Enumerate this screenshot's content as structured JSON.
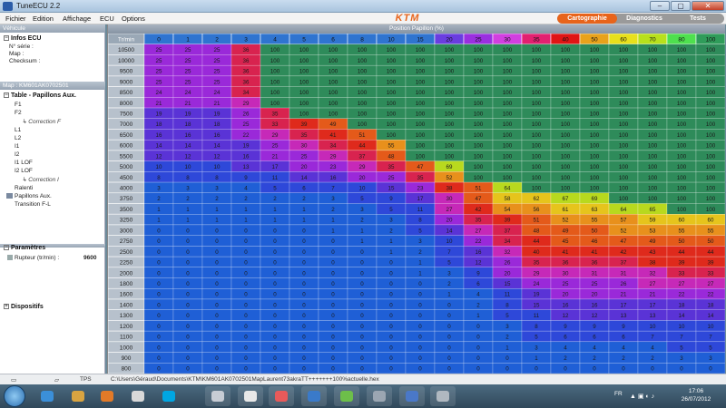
{
  "window": {
    "title": "TuneECU 2.2",
    "minimize": "–",
    "maximize": "▢",
    "close": "✕"
  },
  "menu": [
    "Fichier",
    "Edition",
    "Affichage",
    "ECU",
    "Options"
  ],
  "brand": "KTM",
  "mode_tabs": [
    "Cartographie",
    "Diagnostics",
    "Tests"
  ],
  "left_panel": {
    "vehicule_bar": "Véhicule",
    "infos_title": "Infos ECU",
    "info_lines": [
      "N° série :",
      "Map :",
      "Checksum :"
    ],
    "map_bar": "Map : KM601AK0702501",
    "table_title": "Table - Papillons Aux.",
    "tree": [
      "F1",
      "F2",
      "Correction F",
      "L1",
      "L2",
      "I1",
      "I2",
      "I1 LOF",
      "I2 LOF",
      "Correction I",
      "Ralenti",
      "Papillons Aux.",
      "Transition F-L"
    ],
    "params_title": "Paramètres",
    "param_label": "Rupteur (tr/min) :",
    "param_value": "9600",
    "dispositifs_title": "Dispositifs"
  },
  "grid_title": "Position Papillon (%)",
  "table": {
    "corner": "Tr/min",
    "columns": [
      "0",
      "1",
      "2",
      "3",
      "4",
      "5",
      "6",
      "8",
      "10",
      "15",
      "20",
      "25",
      "30",
      "35",
      "40",
      "50",
      "60",
      "70",
      "80",
      "100"
    ],
    "rows": [
      {
        "rpm": "10500",
        "cells": [
          "25",
          "25",
          "25",
          "36",
          "100",
          "100",
          "100",
          "100",
          "100",
          "100",
          "100",
          "100",
          "100",
          "100",
          "100",
          "100",
          "100",
          "100",
          "100",
          "100"
        ]
      },
      {
        "rpm": "10000",
        "cells": [
          "25",
          "25",
          "25",
          "36",
          "100",
          "100",
          "100",
          "100",
          "100",
          "100",
          "100",
          "100",
          "100",
          "100",
          "100",
          "100",
          "100",
          "100",
          "100",
          "100"
        ]
      },
      {
        "rpm": "9500",
        "cells": [
          "25",
          "25",
          "25",
          "36",
          "100",
          "100",
          "100",
          "100",
          "100",
          "100",
          "100",
          "100",
          "100",
          "100",
          "100",
          "100",
          "100",
          "100",
          "100",
          "100"
        ]
      },
      {
        "rpm": "9000",
        "cells": [
          "25",
          "25",
          "25",
          "36",
          "100",
          "100",
          "100",
          "100",
          "100",
          "100",
          "100",
          "100",
          "100",
          "100",
          "100",
          "100",
          "100",
          "100",
          "100",
          "100"
        ]
      },
      {
        "rpm": "8500",
        "cells": [
          "24",
          "24",
          "24",
          "34",
          "100",
          "100",
          "100",
          "100",
          "100",
          "100",
          "100",
          "100",
          "100",
          "100",
          "100",
          "100",
          "100",
          "100",
          "100",
          "100"
        ]
      },
      {
        "rpm": "8000",
        "cells": [
          "21",
          "21",
          "21",
          "29",
          "100",
          "100",
          "100",
          "100",
          "100",
          "100",
          "100",
          "100",
          "100",
          "100",
          "100",
          "100",
          "100",
          "100",
          "100",
          "100"
        ]
      },
      {
        "rpm": "7500",
        "cells": [
          "19",
          "19",
          "19",
          "26",
          "35",
          "100",
          "100",
          "100",
          "100",
          "100",
          "100",
          "100",
          "100",
          "100",
          "100",
          "100",
          "100",
          "100",
          "100",
          "100"
        ]
      },
      {
        "rpm": "7000",
        "cells": [
          "18",
          "18",
          "18",
          "25",
          "33",
          "39",
          "49",
          "100",
          "100",
          "100",
          "100",
          "100",
          "100",
          "100",
          "100",
          "100",
          "100",
          "100",
          "100",
          "100"
        ]
      },
      {
        "rpm": "6500",
        "cells": [
          "16",
          "16",
          "16",
          "22",
          "29",
          "35",
          "41",
          "51",
          "100",
          "100",
          "100",
          "100",
          "100",
          "100",
          "100",
          "100",
          "100",
          "100",
          "100",
          "100"
        ]
      },
      {
        "rpm": "6000",
        "cells": [
          "14",
          "14",
          "14",
          "19",
          "25",
          "30",
          "34",
          "44",
          "55",
          "100",
          "100",
          "100",
          "100",
          "100",
          "100",
          "100",
          "100",
          "100",
          "100",
          "100"
        ]
      },
      {
        "rpm": "5500",
        "cells": [
          "12",
          "12",
          "12",
          "16",
          "21",
          "25",
          "29",
          "37",
          "48",
          "100",
          "100",
          "100",
          "100",
          "100",
          "100",
          "100",
          "100",
          "100",
          "100",
          "100"
        ]
      },
      {
        "rpm": "5000",
        "cells": [
          "10",
          "10",
          "10",
          "13",
          "17",
          "20",
          "23",
          "29",
          "35",
          "47",
          "69",
          "100",
          "100",
          "100",
          "100",
          "100",
          "100",
          "100",
          "100",
          "100"
        ]
      },
      {
        "rpm": "4500",
        "cells": [
          "8",
          "8",
          "8",
          "9",
          "11",
          "14",
          "16",
          "20",
          "25",
          "35",
          "52",
          "100",
          "100",
          "100",
          "100",
          "100",
          "100",
          "100",
          "100",
          "100"
        ]
      },
      {
        "rpm": "4000",
        "cells": [
          "3",
          "3",
          "3",
          "4",
          "5",
          "6",
          "7",
          "10",
          "15",
          "23",
          "38",
          "51",
          "64",
          "100",
          "100",
          "100",
          "100",
          "100",
          "100",
          "100"
        ]
      },
      {
        "rpm": "3750",
        "cells": [
          "2",
          "2",
          "2",
          "2",
          "2",
          "2",
          "3",
          "5",
          "9",
          "17",
          "30",
          "47",
          "58",
          "62",
          "67",
          "69",
          "100",
          "100",
          "100",
          "100"
        ]
      },
      {
        "rpm": "3500",
        "cells": [
          "1",
          "1",
          "1",
          "1",
          "1",
          "1",
          "2",
          "3",
          "5",
          "11",
          "27",
          "42",
          "54",
          "56",
          "61",
          "63",
          "64",
          "65",
          "100",
          "100"
        ]
      },
      {
        "rpm": "3250",
        "cells": [
          "1",
          "1",
          "1",
          "1",
          "1",
          "1",
          "1",
          "2",
          "3",
          "8",
          "20",
          "35",
          "39",
          "51",
          "52",
          "55",
          "57",
          "59",
          "60",
          "60"
        ]
      },
      {
        "rpm": "3000",
        "cells": [
          "0",
          "0",
          "0",
          "0",
          "0",
          "0",
          "1",
          "1",
          "2",
          "5",
          "14",
          "27",
          "37",
          "48",
          "49",
          "50",
          "52",
          "53",
          "55",
          "55"
        ]
      },
      {
        "rpm": "2750",
        "cells": [
          "0",
          "0",
          "0",
          "0",
          "0",
          "0",
          "0",
          "1",
          "1",
          "3",
          "10",
          "22",
          "34",
          "44",
          "45",
          "46",
          "47",
          "49",
          "50",
          "50"
        ]
      },
      {
        "rpm": "2500",
        "cells": [
          "0",
          "0",
          "0",
          "0",
          "0",
          "0",
          "0",
          "0",
          "1",
          "2",
          "7",
          "16",
          "32",
          "40",
          "41",
          "41",
          "42",
          "43",
          "44",
          "44"
        ]
      },
      {
        "rpm": "2250",
        "cells": [
          "0",
          "0",
          "0",
          "0",
          "0",
          "0",
          "0",
          "0",
          "0",
          "1",
          "5",
          "12",
          "26",
          "35",
          "36",
          "36",
          "37",
          "38",
          "39",
          "39"
        ]
      },
      {
        "rpm": "2000",
        "cells": [
          "0",
          "0",
          "0",
          "0",
          "0",
          "0",
          "0",
          "0",
          "0",
          "1",
          "3",
          "9",
          "20",
          "29",
          "30",
          "31",
          "31",
          "32",
          "33",
          "33"
        ]
      },
      {
        "rpm": "1800",
        "cells": [
          "0",
          "0",
          "0",
          "0",
          "0",
          "0",
          "0",
          "0",
          "0",
          "0",
          "2",
          "6",
          "15",
          "24",
          "25",
          "25",
          "26",
          "27",
          "27",
          "27"
        ]
      },
      {
        "rpm": "1600",
        "cells": [
          "0",
          "0",
          "0",
          "0",
          "0",
          "0",
          "0",
          "0",
          "0",
          "0",
          "1",
          "4",
          "11",
          "19",
          "20",
          "20",
          "21",
          "21",
          "22",
          "22"
        ]
      },
      {
        "rpm": "1400",
        "cells": [
          "0",
          "0",
          "0",
          "0",
          "0",
          "0",
          "0",
          "0",
          "0",
          "0",
          "0",
          "2",
          "8",
          "15",
          "16",
          "16",
          "17",
          "17",
          "18",
          "18"
        ]
      },
      {
        "rpm": "1300",
        "cells": [
          "0",
          "0",
          "0",
          "0",
          "0",
          "0",
          "0",
          "0",
          "0",
          "0",
          "0",
          "1",
          "5",
          "11",
          "12",
          "12",
          "13",
          "13",
          "14",
          "14"
        ]
      },
      {
        "rpm": "1200",
        "cells": [
          "0",
          "0",
          "0",
          "0",
          "0",
          "0",
          "0",
          "0",
          "0",
          "0",
          "0",
          "0",
          "3",
          "8",
          "9",
          "9",
          "9",
          "10",
          "10",
          "10"
        ]
      },
      {
        "rpm": "1100",
        "cells": [
          "0",
          "0",
          "0",
          "0",
          "0",
          "0",
          "0",
          "0",
          "0",
          "0",
          "0",
          "0",
          "2",
          "5",
          "6",
          "6",
          "6",
          "7",
          "7",
          "7"
        ]
      },
      {
        "rpm": "1000",
        "cells": [
          "0",
          "0",
          "0",
          "0",
          "0",
          "0",
          "0",
          "0",
          "0",
          "0",
          "0",
          "0",
          "1",
          "3",
          "4",
          "4",
          "4",
          "4",
          "5",
          "5"
        ]
      },
      {
        "rpm": "900",
        "cells": [
          "0",
          "0",
          "0",
          "0",
          "0",
          "0",
          "0",
          "0",
          "0",
          "0",
          "0",
          "0",
          "0",
          "1",
          "2",
          "2",
          "2",
          "2",
          "3",
          "3"
        ]
      },
      {
        "rpm": "800",
        "cells": [
          "0",
          "0",
          "0",
          "0",
          "0",
          "0",
          "0",
          "0",
          "0",
          "0",
          "0",
          "0",
          "0",
          "0",
          "0",
          "0",
          "0",
          "0",
          "0",
          "0"
        ]
      }
    ]
  },
  "status": {
    "tps_label": "TPS",
    "path": "C:\\Users\\Géraud\\Documents\\KTM\\KM601AK0702501MapLaurent73akraTT+++++++100%actuelle.hex"
  },
  "taskbar": {
    "icons": [
      "windows-start-icon",
      "ie-icon",
      "folder-icon",
      "media-icon",
      "chrome-icon",
      "skype-icon",
      "app-icon",
      "paint-icon",
      "game-icon",
      "earth-icon",
      "palette-icon",
      "fan-icon",
      "grid-icon",
      "explorer-icon"
    ],
    "lang": "FR",
    "time": "17:06",
    "date": "26/07/2012"
  },
  "colors": {
    "accent": "#e8641b",
    "header_blue": "#2f74d0",
    "col_header_colors": [
      "#2f74d0",
      "#2f74d0",
      "#2f74d0",
      "#2f74d0",
      "#2f74d0",
      "#2f74d0",
      "#2f74d0",
      "#2f74d0",
      "#2f74d0",
      "#2f74d0",
      "#6a3de0",
      "#9a2fe0",
      "#d23fe0",
      "#e22070",
      "#e01515",
      "#e8a21b",
      "#e8e01b",
      "#b8e01b",
      "#4ee04e",
      "#2f9c5a"
    ]
  }
}
